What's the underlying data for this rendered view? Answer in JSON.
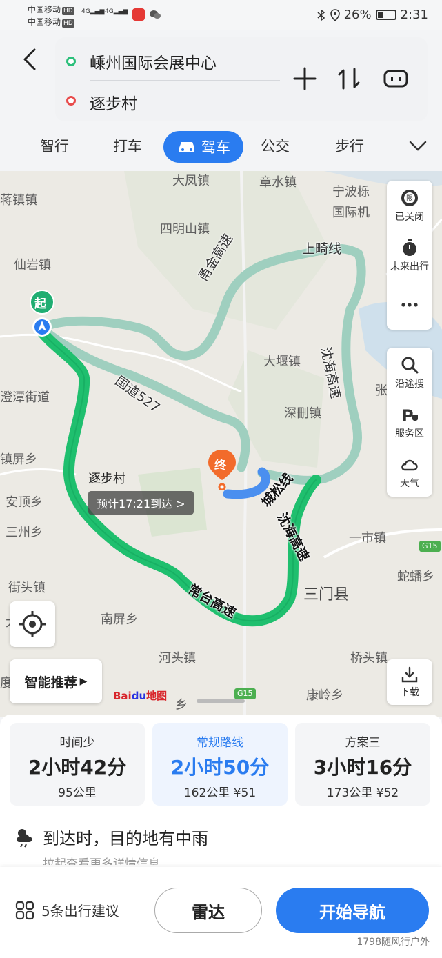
{
  "status_bar": {
    "carrier1": "中国移动",
    "carrier2": "中国移动",
    "hd": "HD",
    "net1": "4G",
    "net2": "4G",
    "battery": "26%",
    "time": "2:31"
  },
  "route": {
    "origin": "嵊州国际会展中心",
    "destination": "逐步村"
  },
  "tabs": {
    "smart": "智行",
    "taxi": "打车",
    "drive": "驾车",
    "bus": "公交",
    "walk": "步行"
  },
  "map": {
    "labels": {
      "dafeng": "大凤镇",
      "zhangshui": "章水镇",
      "ningbo1": "宁波栎",
      "ningbo2": "国际机",
      "jiangzhen": "蒋镇镇",
      "simingshan": "四明山镇",
      "xianyan": "仙岩镇",
      "dayan": "大堰镇",
      "chengtan": "澄潭街道",
      "shenyi": "深刪镇",
      "zhenping": "镇屏乡",
      "anding": "安顶乡",
      "sanzhou": "三州乡",
      "jietou": "街头镇",
      "yishi": "一市镇",
      "sanmen": "三门县",
      "shepan": "蛇蟠乡",
      "nanping": "南屏乡",
      "hetou": "河头镇",
      "qiaotou": "桥头镇",
      "kangling": "康岭乡",
      "zhang": "张",
      "du": "度",
      "da": "大",
      "xiang": "乡",
      "zhubucun": "逐步村"
    },
    "roads": {
      "shangqi": "上畸线",
      "yongjin": "甬金高速",
      "shenhai1": "沈海高速",
      "guodao": "国道527",
      "chengsong": "城松线",
      "shenhai2": "沈海高速",
      "changtai": "常台高速"
    },
    "badges": {
      "g15a": "G15",
      "g15b": "G15"
    },
    "start_pin": "起",
    "end_pin": "终",
    "eta": "预计17:21到达 >",
    "logo_text": "Bai",
    "logo_du": "du",
    "logo_suffix": "地图"
  },
  "side_panel": {
    "restrict": "已关闭",
    "future": "未来出行",
    "search_along": "沿途搜",
    "service": "服务区",
    "weather": "天气"
  },
  "buttons": {
    "smart_recommend": "智能推荐",
    "download": "下载"
  },
  "plans": [
    {
      "name": "时间少",
      "time": "2小时42分",
      "meta": "95公里"
    },
    {
      "name": "常规路线",
      "time": "2小时50分",
      "meta": "162公里 ¥51"
    },
    {
      "name": "方案三",
      "time": "3小时16分",
      "meta": "173公里 ¥52"
    }
  ],
  "weather": {
    "main": "到达时，目的地有中雨",
    "sub": "拉起查看更多详情信息"
  },
  "actions": {
    "suggest": "5条出行建议",
    "radar": "雷达",
    "navigate": "开始导航"
  },
  "watermark": "1798随风行户外",
  "colors": {
    "accent": "#2a7cf0",
    "route_main": "#1fbf6e",
    "route_alt": "#9fcfbf",
    "start_pin": "#1fae72",
    "end_pin": "#f26b2b"
  }
}
